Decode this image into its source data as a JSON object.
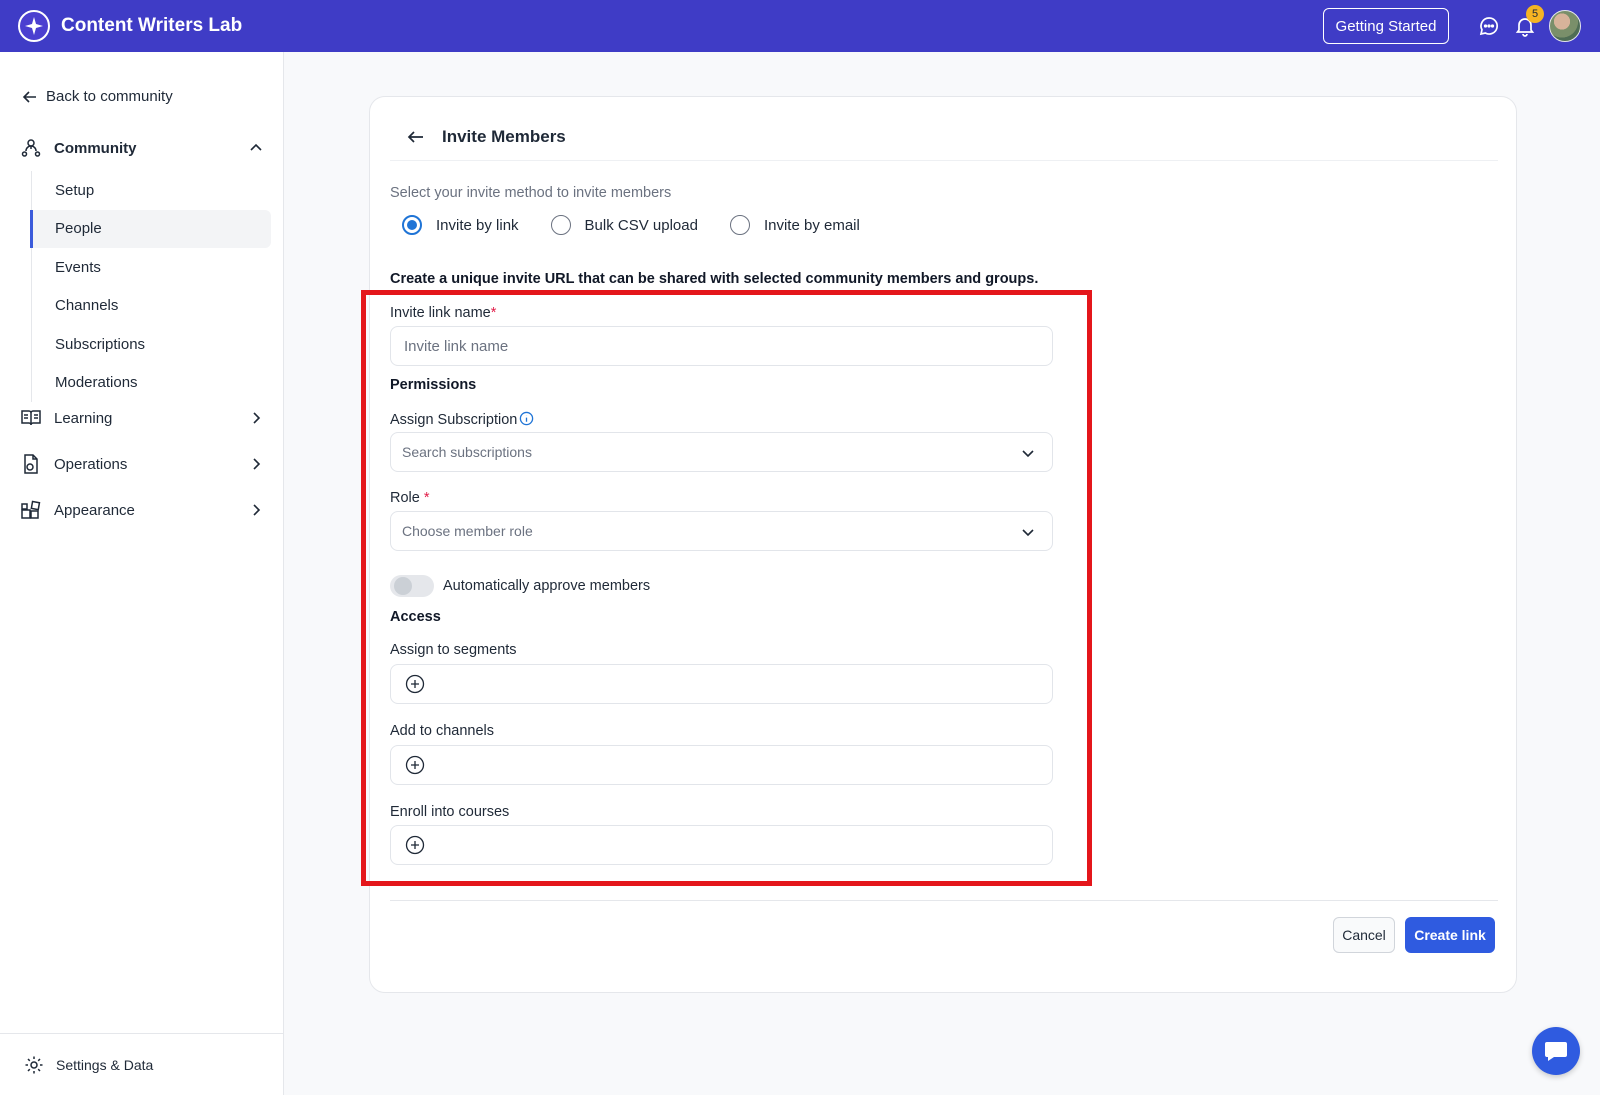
{
  "app": {
    "title": "Content Writers Lab",
    "getting_started": "Getting Started",
    "notification_count": "5"
  },
  "sidebar": {
    "back": "Back to community",
    "community": "Community",
    "items": [
      "Setup",
      "People",
      "Events",
      "Channels",
      "Subscriptions",
      "Moderations"
    ],
    "active_item": "People",
    "learning": "Learning",
    "operations": "Operations",
    "appearance": "Appearance",
    "settings": "Settings & Data"
  },
  "card": {
    "title": "Invite Members",
    "method_label": "Select your invite method to invite members",
    "methods": [
      "Invite by link",
      "Bulk CSV upload",
      "Invite by email"
    ],
    "selected_method": "Invite by link",
    "description": "Create a unique invite URL that can be shared with selected community members and groups.",
    "link_name_label": "Invite link name",
    "required_mark": "*",
    "link_name_placeholder": "Invite link name",
    "permissions": "Permissions",
    "subscription_label": "Assign Subscription",
    "subscription_placeholder": "Search subscriptions",
    "role_label": "Role",
    "role_placeholder": "Choose member role",
    "auto_approve": "Automatically approve members",
    "auto_approve_on": false,
    "access": "Access",
    "segments_label": "Assign to segments",
    "channels_label": "Add to channels",
    "courses_label": "Enroll into courses",
    "cancel": "Cancel",
    "create": "Create link"
  },
  "colors": {
    "topbar": "#3f3cc6",
    "primary": "#2f5be0",
    "highlight": "#e4161b"
  }
}
